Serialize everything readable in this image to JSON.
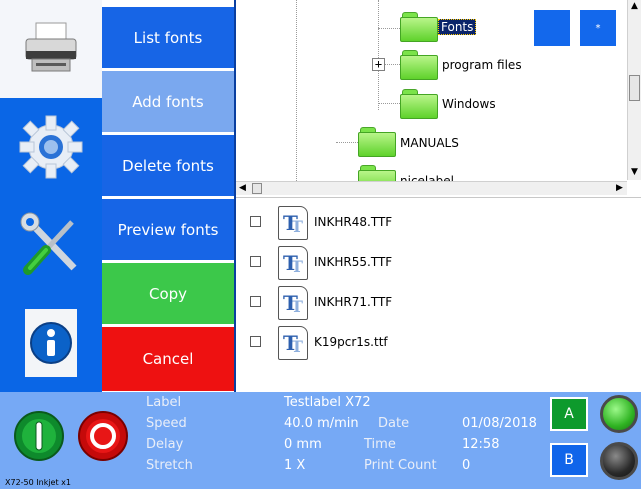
{
  "menu": {
    "list_fonts": "List fonts",
    "add_fonts": "Add fonts",
    "delete_fonts": "Delete fonts",
    "preview_fonts": "Preview fonts",
    "copy": "Copy",
    "cancel": "Cancel"
  },
  "rail": {
    "items": [
      "printer-icon",
      "settings-gear-icon",
      "tools-icon",
      "info-icon"
    ],
    "active": "printer-icon"
  },
  "tree": {
    "items": [
      {
        "label": "Fonts",
        "selected": true
      },
      {
        "label": "program files",
        "expandable": true
      },
      {
        "label": "Windows"
      },
      {
        "label": "MANUALS"
      },
      {
        "label": "nicelabel"
      }
    ],
    "button_2": "*"
  },
  "files": [
    {
      "name": "INKHR48.TTF"
    },
    {
      "name": "INKHR55.TTF"
    },
    {
      "name": "INKHR71.TTF"
    },
    {
      "name": "K19pcr1s.ttf"
    }
  ],
  "status": {
    "label_key": "Label",
    "label_value": "Testlabel X72",
    "speed_key": "Speed",
    "speed_value": "40.0 m/min",
    "date_key": "Date",
    "date_value": "01/08/2018",
    "delay_key": "Delay",
    "delay_value": "0 mm",
    "time_key": "Time",
    "time_value": "12:58",
    "stretch_key": "Stretch",
    "stretch_value": "1 X",
    "print_count_key": "Print Count",
    "print_count_value": "0",
    "model": "X72-50 Inkjet x1",
    "btn_a": "A",
    "btn_b": "B"
  },
  "colors": {
    "rail_blue": "#0a66e6",
    "menu_blue": "#1765e6",
    "menu_light": "#7aa8ef",
    "copy_green": "#3cc84a",
    "cancel_red": "#ee1111",
    "status_blue": "#76a9f5"
  }
}
